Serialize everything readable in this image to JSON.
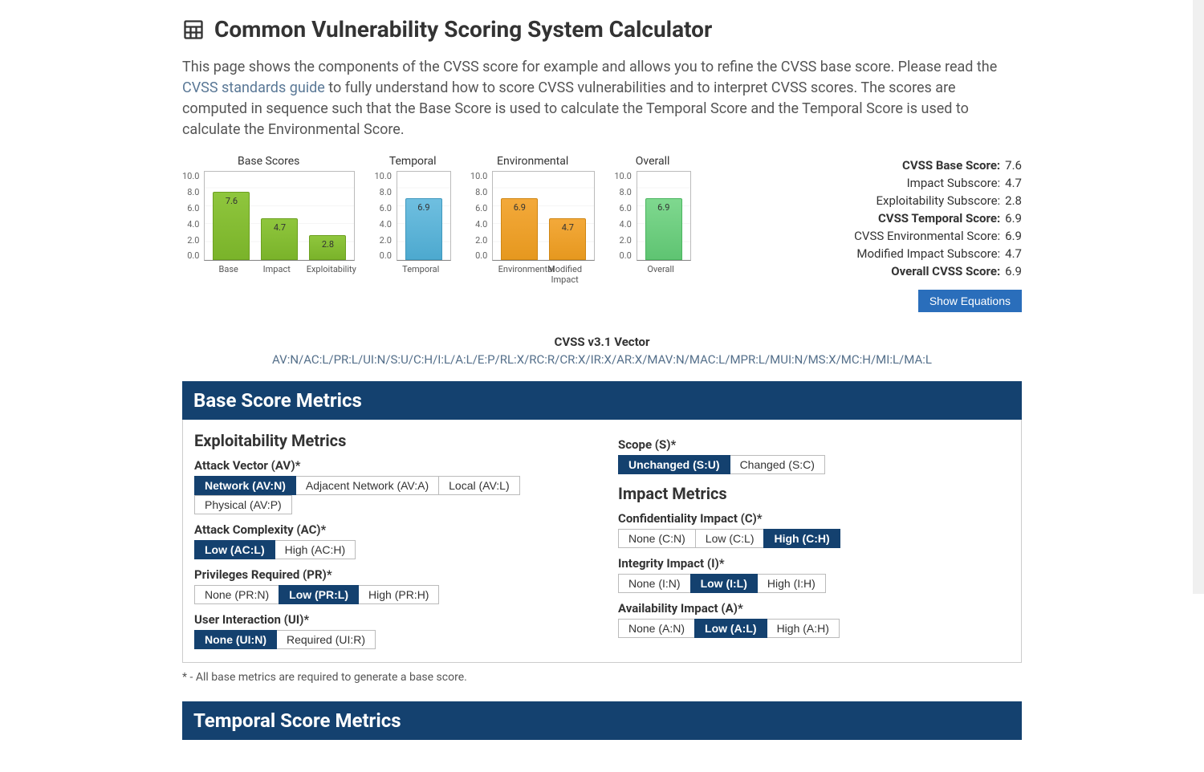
{
  "page": {
    "title": "Common Vulnerability Scoring System Calculator",
    "intro_pre": "This page shows the components of the CVSS score for example and allows you to refine the CVSS base score. Please read the ",
    "intro_link": "CVSS standards guide",
    "intro_post": " to fully understand how to score CVSS vulnerabilities and to interpret CVSS scores. The scores are computed in sequence such that the Base Score is used to calculate the Temporal Score and the Temporal Score is used to calculate the Environmental Score."
  },
  "chart_data": [
    {
      "type": "bar",
      "title": "Base Scores",
      "ylim": [
        0,
        10
      ],
      "categories": [
        "Base",
        "Impact",
        "Exploitability"
      ],
      "values": [
        7.6,
        4.7,
        2.8
      ],
      "color": "green"
    },
    {
      "type": "bar",
      "title": "Temporal",
      "ylim": [
        0,
        10
      ],
      "categories": [
        "Temporal"
      ],
      "values": [
        6.9
      ],
      "color": "blue"
    },
    {
      "type": "bar",
      "title": "Environmental",
      "ylim": [
        0,
        10
      ],
      "categories": [
        "Environmental",
        "Modified Impact"
      ],
      "values": [
        6.9,
        4.7
      ],
      "color": "orange"
    },
    {
      "type": "bar",
      "title": "Overall",
      "ylim": [
        0,
        10
      ],
      "categories": [
        "Overall"
      ],
      "values": [
        6.9
      ],
      "color": "mint"
    }
  ],
  "summary": [
    {
      "label": "CVSS Base Score:",
      "value": "7.6",
      "bold": true
    },
    {
      "label": "Impact Subscore:",
      "value": "4.7",
      "bold": false
    },
    {
      "label": "Exploitability Subscore:",
      "value": "2.8",
      "bold": false
    },
    {
      "label": "CVSS Temporal Score:",
      "value": "6.9",
      "bold": true
    },
    {
      "label": "CVSS Environmental Score:",
      "value": "6.9",
      "bold": false
    },
    {
      "label": "Modified Impact Subscore:",
      "value": "4.7",
      "bold": false
    },
    {
      "label": "Overall CVSS Score:",
      "value": "6.9",
      "bold": true
    }
  ],
  "show_equations": "Show Equations",
  "vector": {
    "title": "CVSS v3.1 Vector",
    "value": "AV:N/AC:L/PR:L/UI:N/S:U/C:H/I:L/A:L/E:P/RL:X/RC:R/CR:X/IR:X/AR:X/MAV:N/MAC:L/MPR:L/MUI:N/MS:X/MC:H/MI:L/MA:L"
  },
  "sections": {
    "base_header": "Base Score Metrics",
    "temporal_header": "Temporal Score Metrics"
  },
  "left_col": {
    "heading": "Exploitability Metrics",
    "metrics": [
      {
        "label": "Attack Vector (AV)*",
        "options": [
          "Network (AV:N)",
          "Adjacent Network (AV:A)",
          "Local (AV:L)",
          "Physical (AV:P)"
        ],
        "selected": 0
      },
      {
        "label": "Attack Complexity (AC)*",
        "options": [
          "Low (AC:L)",
          "High (AC:H)"
        ],
        "selected": 0
      },
      {
        "label": "Privileges Required (PR)*",
        "options": [
          "None (PR:N)",
          "Low (PR:L)",
          "High (PR:H)"
        ],
        "selected": 1
      },
      {
        "label": "User Interaction (UI)*",
        "options": [
          "None (UI:N)",
          "Required (UI:R)"
        ],
        "selected": 0
      }
    ]
  },
  "right_col": {
    "scope": {
      "label": "Scope (S)*",
      "options": [
        "Unchanged (S:U)",
        "Changed (S:C)"
      ],
      "selected": 0
    },
    "heading": "Impact Metrics",
    "metrics": [
      {
        "label": "Confidentiality Impact (C)*",
        "options": [
          "None (C:N)",
          "Low (C:L)",
          "High (C:H)"
        ],
        "selected": 2
      },
      {
        "label": "Integrity Impact (I)*",
        "options": [
          "None (I:N)",
          "Low (I:L)",
          "High (I:H)"
        ],
        "selected": 1
      },
      {
        "label": "Availability Impact (A)*",
        "options": [
          "None (A:N)",
          "Low (A:L)",
          "High (A:H)"
        ],
        "selected": 1
      }
    ]
  },
  "footnote": "* - All base metrics are required to generate a base score.",
  "yticks": [
    "10.0",
    "8.0",
    "6.0",
    "4.0",
    "2.0",
    "0.0"
  ]
}
